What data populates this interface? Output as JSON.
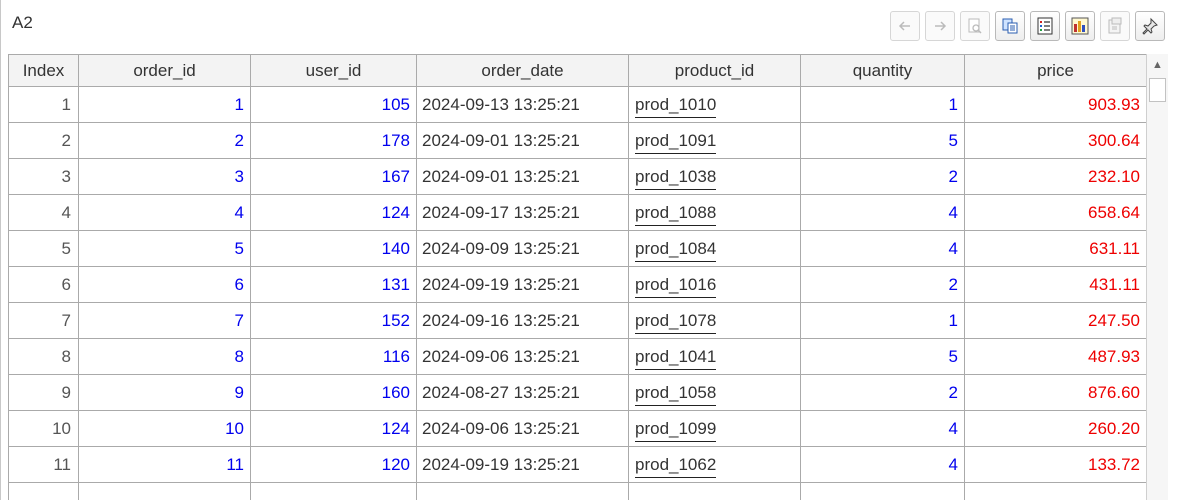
{
  "cell_ref": "A2",
  "toolbar": [
    {
      "name": "back-icon",
      "enabled": false
    },
    {
      "name": "forward-icon",
      "enabled": false
    },
    {
      "name": "zoom-icon",
      "enabled": false
    },
    {
      "name": "copy-icon",
      "enabled": true
    },
    {
      "name": "list-view-icon",
      "enabled": true
    },
    {
      "name": "chart-icon",
      "enabled": true
    },
    {
      "name": "export-icon",
      "enabled": false
    },
    {
      "name": "pin-icon",
      "enabled": true
    }
  ],
  "table": {
    "columns": [
      "Index",
      "order_id",
      "user_id",
      "order_date",
      "product_id",
      "quantity",
      "price"
    ],
    "rows": [
      [
        "1",
        "1",
        "105",
        "2024-09-13 13:25:21",
        "prod_1010",
        "1",
        "903.93"
      ],
      [
        "2",
        "2",
        "178",
        "2024-09-01 13:25:21",
        "prod_1091",
        "5",
        "300.64"
      ],
      [
        "3",
        "3",
        "167",
        "2024-09-01 13:25:21",
        "prod_1038",
        "2",
        "232.10"
      ],
      [
        "4",
        "4",
        "124",
        "2024-09-17 13:25:21",
        "prod_1088",
        "4",
        "658.64"
      ],
      [
        "5",
        "5",
        "140",
        "2024-09-09 13:25:21",
        "prod_1084",
        "4",
        "631.11"
      ],
      [
        "6",
        "6",
        "131",
        "2024-09-19 13:25:21",
        "prod_1016",
        "2",
        "431.11"
      ],
      [
        "7",
        "7",
        "152",
        "2024-09-16 13:25:21",
        "prod_1078",
        "1",
        "247.50"
      ],
      [
        "8",
        "8",
        "116",
        "2024-09-06 13:25:21",
        "prod_1041",
        "5",
        "487.93"
      ],
      [
        "9",
        "9",
        "160",
        "2024-08-27 13:25:21",
        "prod_1058",
        "2",
        "876.60"
      ],
      [
        "10",
        "10",
        "124",
        "2024-09-06 13:25:21",
        "prod_1099",
        "4",
        "260.20"
      ],
      [
        "11",
        "11",
        "120",
        "2024-09-19 13:25:21",
        "prod_1062",
        "4",
        "133.72"
      ],
      [
        "",
        "",
        "",
        "",
        "",
        "",
        ""
      ]
    ]
  },
  "colors": {
    "number_text": "#0000ee",
    "price_text": "#ee0000",
    "grid_line": "#aaaaaa",
    "header_bg": "#f3f3f3"
  }
}
